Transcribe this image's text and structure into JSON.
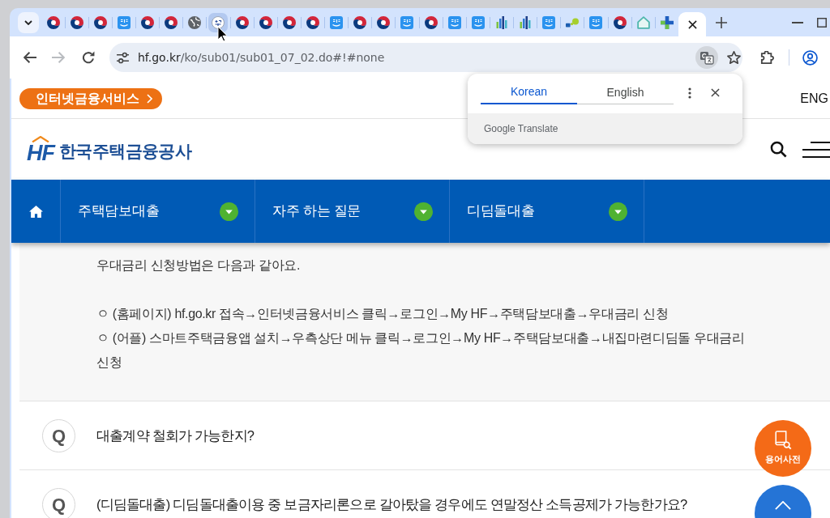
{
  "browser": {
    "tabs": [
      {
        "kind": "taegeuk",
        "selected": false,
        "hovered": false
      },
      {
        "kind": "taegeuk",
        "selected": false,
        "hovered": false
      },
      {
        "kind": "taegeuk",
        "selected": false,
        "hovered": false
      },
      {
        "kind": "app",
        "selected": false,
        "hovered": false
      },
      {
        "kind": "taegeuk",
        "selected": false,
        "hovered": false
      },
      {
        "kind": "taegeuk",
        "selected": false,
        "hovered": false
      },
      {
        "kind": "globe",
        "selected": false,
        "hovered": false
      },
      {
        "kind": "seal",
        "selected": false,
        "hovered": true
      },
      {
        "kind": "taegeuk",
        "selected": false,
        "hovered": false
      },
      {
        "kind": "taegeuk",
        "selected": false,
        "hovered": false
      },
      {
        "kind": "taegeuk",
        "selected": false,
        "hovered": false
      },
      {
        "kind": "taegeuk",
        "selected": false,
        "hovered": false
      },
      {
        "kind": "app",
        "selected": false,
        "hovered": false
      },
      {
        "kind": "taegeuk",
        "selected": false,
        "hovered": false
      },
      {
        "kind": "taegeuk",
        "selected": false,
        "hovered": false
      },
      {
        "kind": "app",
        "selected": false,
        "hovered": false
      },
      {
        "kind": "taegeuk",
        "selected": false,
        "hovered": false
      },
      {
        "kind": "app",
        "selected": false,
        "hovered": false
      },
      {
        "kind": "app",
        "selected": false,
        "hovered": false
      },
      {
        "kind": "bars",
        "selected": false,
        "hovered": false
      },
      {
        "kind": "bars",
        "selected": false,
        "hovered": false
      },
      {
        "kind": "app",
        "selected": false,
        "hovered": false
      },
      {
        "kind": "dots",
        "selected": false,
        "hovered": false
      },
      {
        "kind": "app",
        "selected": false,
        "hovered": false
      },
      {
        "kind": "taegeuk",
        "selected": false,
        "hovered": false
      },
      {
        "kind": "house",
        "selected": false,
        "hovered": false
      },
      {
        "kind": "plus",
        "selected": false,
        "hovered": false
      },
      {
        "selected": true,
        "hovered": false
      }
    ],
    "nav_buttons": [
      {
        "kind": "back",
        "disabled": false
      },
      {
        "kind": "forward",
        "disabled": true
      },
      {
        "kind": "reload",
        "disabled": false
      }
    ],
    "address": {
      "host": "hf.go.kr",
      "path": "/ko/sub01/sub01_07_02.do#!#none"
    },
    "translate_button": {
      "on": true
    }
  },
  "translate_popup": {
    "languages": [
      {
        "label": "Korean",
        "selected": true
      },
      {
        "label": "English",
        "selected": false
      }
    ],
    "footer": "Google Translate"
  },
  "page": {
    "service_button": "인터넷금융서비스",
    "language_link": "ENG",
    "logo": {
      "mark": "HF",
      "name": "한국주택금융공사"
    },
    "nav": [
      {
        "label": "주택담보대출"
      },
      {
        "label": "자주 하는 질문"
      },
      {
        "label": "디딤돌대출"
      }
    ],
    "answer": [
      "우대금리 신청방법은 다음과 같아요.",
      "ㅇ (홈페이지) hf.go.kr 접속→인터넷금융서비스 클릭→로그인→My HF→주택담보대출→우대금리 신청",
      "ㅇ (어플) 스마트주택금융앱 설치→우측상단 메뉴 클릭→로그인→My HF→주택담보대출→내집마련디딤돌 우대금리 신청"
    ],
    "questions": [
      {
        "marker": "Q",
        "text": "대출계약 철회가 가능한지?"
      },
      {
        "marker": "Q",
        "text": "(디딤돌대출) 디딤돌대출이용 중 보금자리론으로 갈아탔을 경우에도 연말정산 소득공제가 가능한가요?"
      }
    ],
    "floating_buttons": [
      {
        "kind": "glossary",
        "label": "용어사전"
      },
      {
        "kind": "top"
      }
    ]
  }
}
